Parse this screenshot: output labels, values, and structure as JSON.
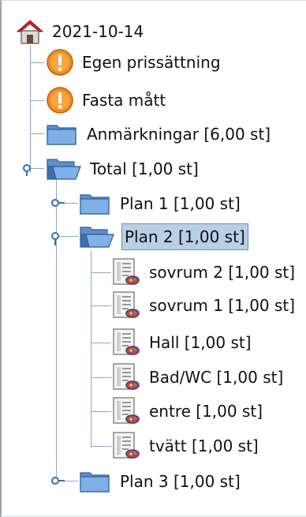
{
  "tree": {
    "root": {
      "label": "2021-10-14",
      "icon": "home-icon"
    },
    "warnings": [
      {
        "label": "Egen prissättning",
        "icon": "warning-icon"
      },
      {
        "label": "Fasta mått",
        "icon": "warning-icon"
      }
    ],
    "notes": {
      "label": "Anmärkningar [6,00 st]",
      "icon": "folder-icon"
    },
    "total": {
      "label": "Total [1,00 st]",
      "icon": "open-folder-icon",
      "expanded": true,
      "plans": [
        {
          "label": "Plan 1 [1,00 st]",
          "icon": "folder-icon",
          "expanded": false
        },
        {
          "label": "Plan 2 [1,00 st]",
          "icon": "open-folder-icon",
          "expanded": true,
          "selected": true,
          "rooms": [
            {
              "label": "sovrum 2 [1,00 st]",
              "icon": "room-document-icon"
            },
            {
              "label": "sovrum 1 [1,00 st]",
              "icon": "room-document-icon"
            },
            {
              "label": "Hall [1,00 st]",
              "icon": "room-document-icon"
            },
            {
              "label": "Bad/WC [1,00 st]",
              "icon": "room-document-icon"
            },
            {
              "label": "entre [1,00 st]",
              "icon": "room-document-icon"
            },
            {
              "label": "tvätt [1,00 st]",
              "icon": "room-document-icon"
            }
          ]
        },
        {
          "label": "Plan 3 [1,00 st]",
          "icon": "folder-icon",
          "expanded": false
        }
      ]
    }
  },
  "colors": {
    "selection_bg": "#b8cfe5",
    "connector": "#8fa8c4",
    "folder": "#6f9fd8",
    "warning": "#f28c1e",
    "home_roof": "#d9262b"
  }
}
